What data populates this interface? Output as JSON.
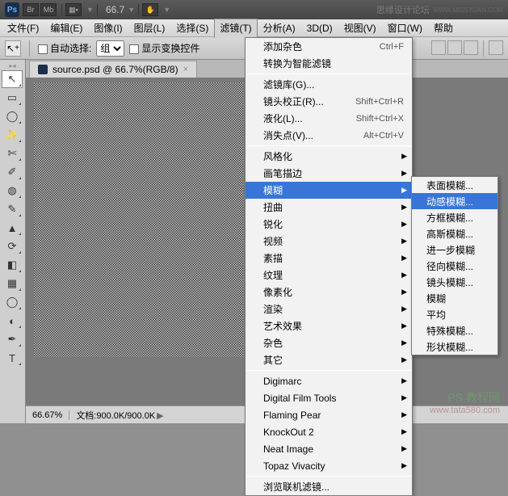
{
  "titlebar": {
    "ps": "Ps",
    "btn1": "Br",
    "btn2": "Mb",
    "zoom": "66.7",
    "watermark": "思缘设计论坛",
    "url": "WWW.MISSYUAN.COM"
  },
  "menubar": {
    "items": [
      "文件(F)",
      "编辑(E)",
      "图像(I)",
      "图层(L)",
      "选择(S)",
      "滤镜(T)",
      "分析(A)",
      "3D(D)",
      "视图(V)",
      "窗口(W)",
      "帮助"
    ]
  },
  "optbar": {
    "auto_select": "自动选择:",
    "group": "组",
    "show_transform": "显示变换控件"
  },
  "doctab": {
    "title": "source.psd @ 66.7%(RGB/8)"
  },
  "statusbar": {
    "zoom": "66.67%",
    "info": "文档:900.0K/900.0K"
  },
  "menu": {
    "items": [
      {
        "label": "添加杂色",
        "shortcut": "Ctrl+F"
      },
      {
        "label": "转换为智能滤镜"
      },
      {
        "sep": true
      },
      {
        "label": "滤镜库(G)..."
      },
      {
        "label": "镜头校正(R)...",
        "shortcut": "Shift+Ctrl+R"
      },
      {
        "label": "液化(L)...",
        "shortcut": "Shift+Ctrl+X"
      },
      {
        "label": "消失点(V)...",
        "shortcut": "Alt+Ctrl+V"
      },
      {
        "sep": true
      },
      {
        "label": "风格化",
        "sub": true
      },
      {
        "label": "画笔描边",
        "sub": true
      },
      {
        "label": "模糊",
        "sub": true,
        "hover": true
      },
      {
        "label": "扭曲",
        "sub": true
      },
      {
        "label": "锐化",
        "sub": true
      },
      {
        "label": "视频",
        "sub": true
      },
      {
        "label": "素描",
        "sub": true
      },
      {
        "label": "纹理",
        "sub": true
      },
      {
        "label": "像素化",
        "sub": true
      },
      {
        "label": "渲染",
        "sub": true
      },
      {
        "label": "艺术效果",
        "sub": true
      },
      {
        "label": "杂色",
        "sub": true
      },
      {
        "label": "其它",
        "sub": true
      },
      {
        "sep": true
      },
      {
        "label": "Digimarc",
        "sub": true
      },
      {
        "label": "Digital Film Tools",
        "sub": true
      },
      {
        "label": "Flaming Pear",
        "sub": true
      },
      {
        "label": "KnockOut 2",
        "sub": true
      },
      {
        "label": "Neat Image",
        "sub": true
      },
      {
        "label": "Topaz Vivacity",
        "sub": true
      },
      {
        "sep": true
      },
      {
        "label": "浏览联机滤镜..."
      }
    ]
  },
  "submenu": {
    "items": [
      {
        "label": "表面模糊..."
      },
      {
        "label": "动感模糊...",
        "hover": true
      },
      {
        "label": "方框模糊..."
      },
      {
        "label": "高斯模糊..."
      },
      {
        "label": "进一步模糊"
      },
      {
        "label": "径向模糊..."
      },
      {
        "label": "镜头模糊..."
      },
      {
        "label": "模糊"
      },
      {
        "label": "平均"
      },
      {
        "label": "特殊模糊..."
      },
      {
        "label": "形状模糊..."
      }
    ]
  },
  "tools": [
    "▲",
    "▭",
    "◌",
    "✎",
    "⟋",
    "✄",
    "✐",
    "◉",
    "▦",
    "△",
    "✎",
    "◧",
    "⬚",
    "✎",
    "◯",
    "✐",
    "T"
  ],
  "bg_wm": {
    "line1": "PS 教程网",
    "line2": "www.tata580.com"
  }
}
